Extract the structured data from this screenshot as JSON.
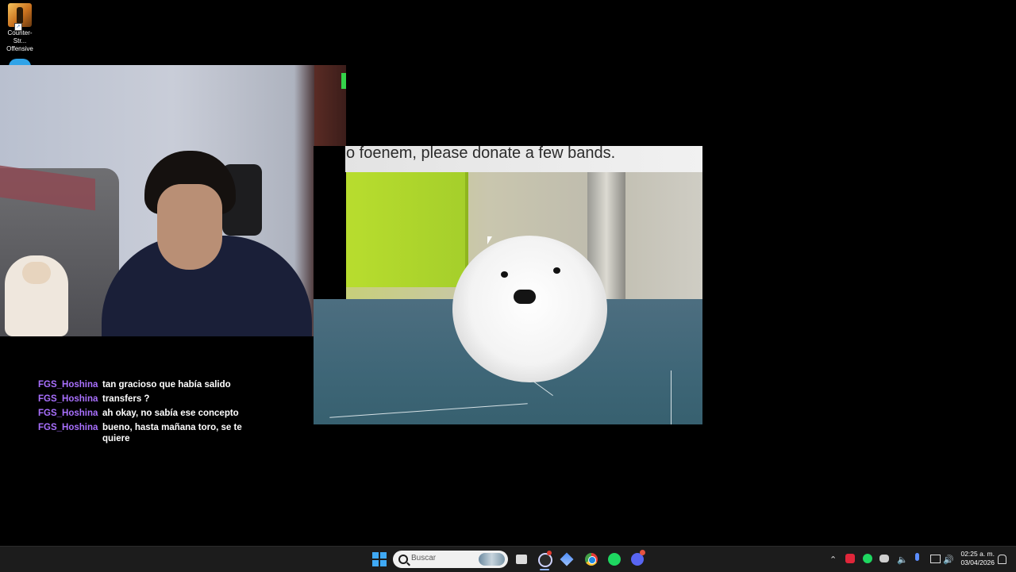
{
  "desktop": {
    "icons": [
      {
        "label_line1": "Counter-Str...",
        "label_line2": "Offensive",
        "icon": "counter-strike-icon"
      }
    ]
  },
  "chat": {
    "username_color": "#a970ff",
    "messages": [
      {
        "user": "FGS_Hoshina",
        "text": "tan gracioso que había salido"
      },
      {
        "user": "FGS_Hoshina",
        "text": "transfers ?"
      },
      {
        "user": "FGS_Hoshina",
        "text": "ah okay, no sabía ese concepto"
      },
      {
        "user": "FGS_Hoshina",
        "text": "bueno, hasta mañana toro, se te quiere"
      }
    ]
  },
  "overlay_image": {
    "caption": "o foenem, please donate a few bands."
  },
  "taskbar": {
    "search_placeholder": "Buscar",
    "apps": [
      "start-icon",
      "task-view-icon",
      "snipping-tool-icon",
      "diamond-app-icon",
      "chrome-icon",
      "spotify-icon",
      "discord-icon"
    ],
    "tray": [
      "chevron-up-icon",
      "recording-icon",
      "spotify-tray-icon",
      "discord-tray-icon",
      "speaker-icon",
      "microphone-icon",
      "network-icon",
      "volume-icon"
    ],
    "time": "02:25 a. m.",
    "date": "03/04/2026"
  }
}
